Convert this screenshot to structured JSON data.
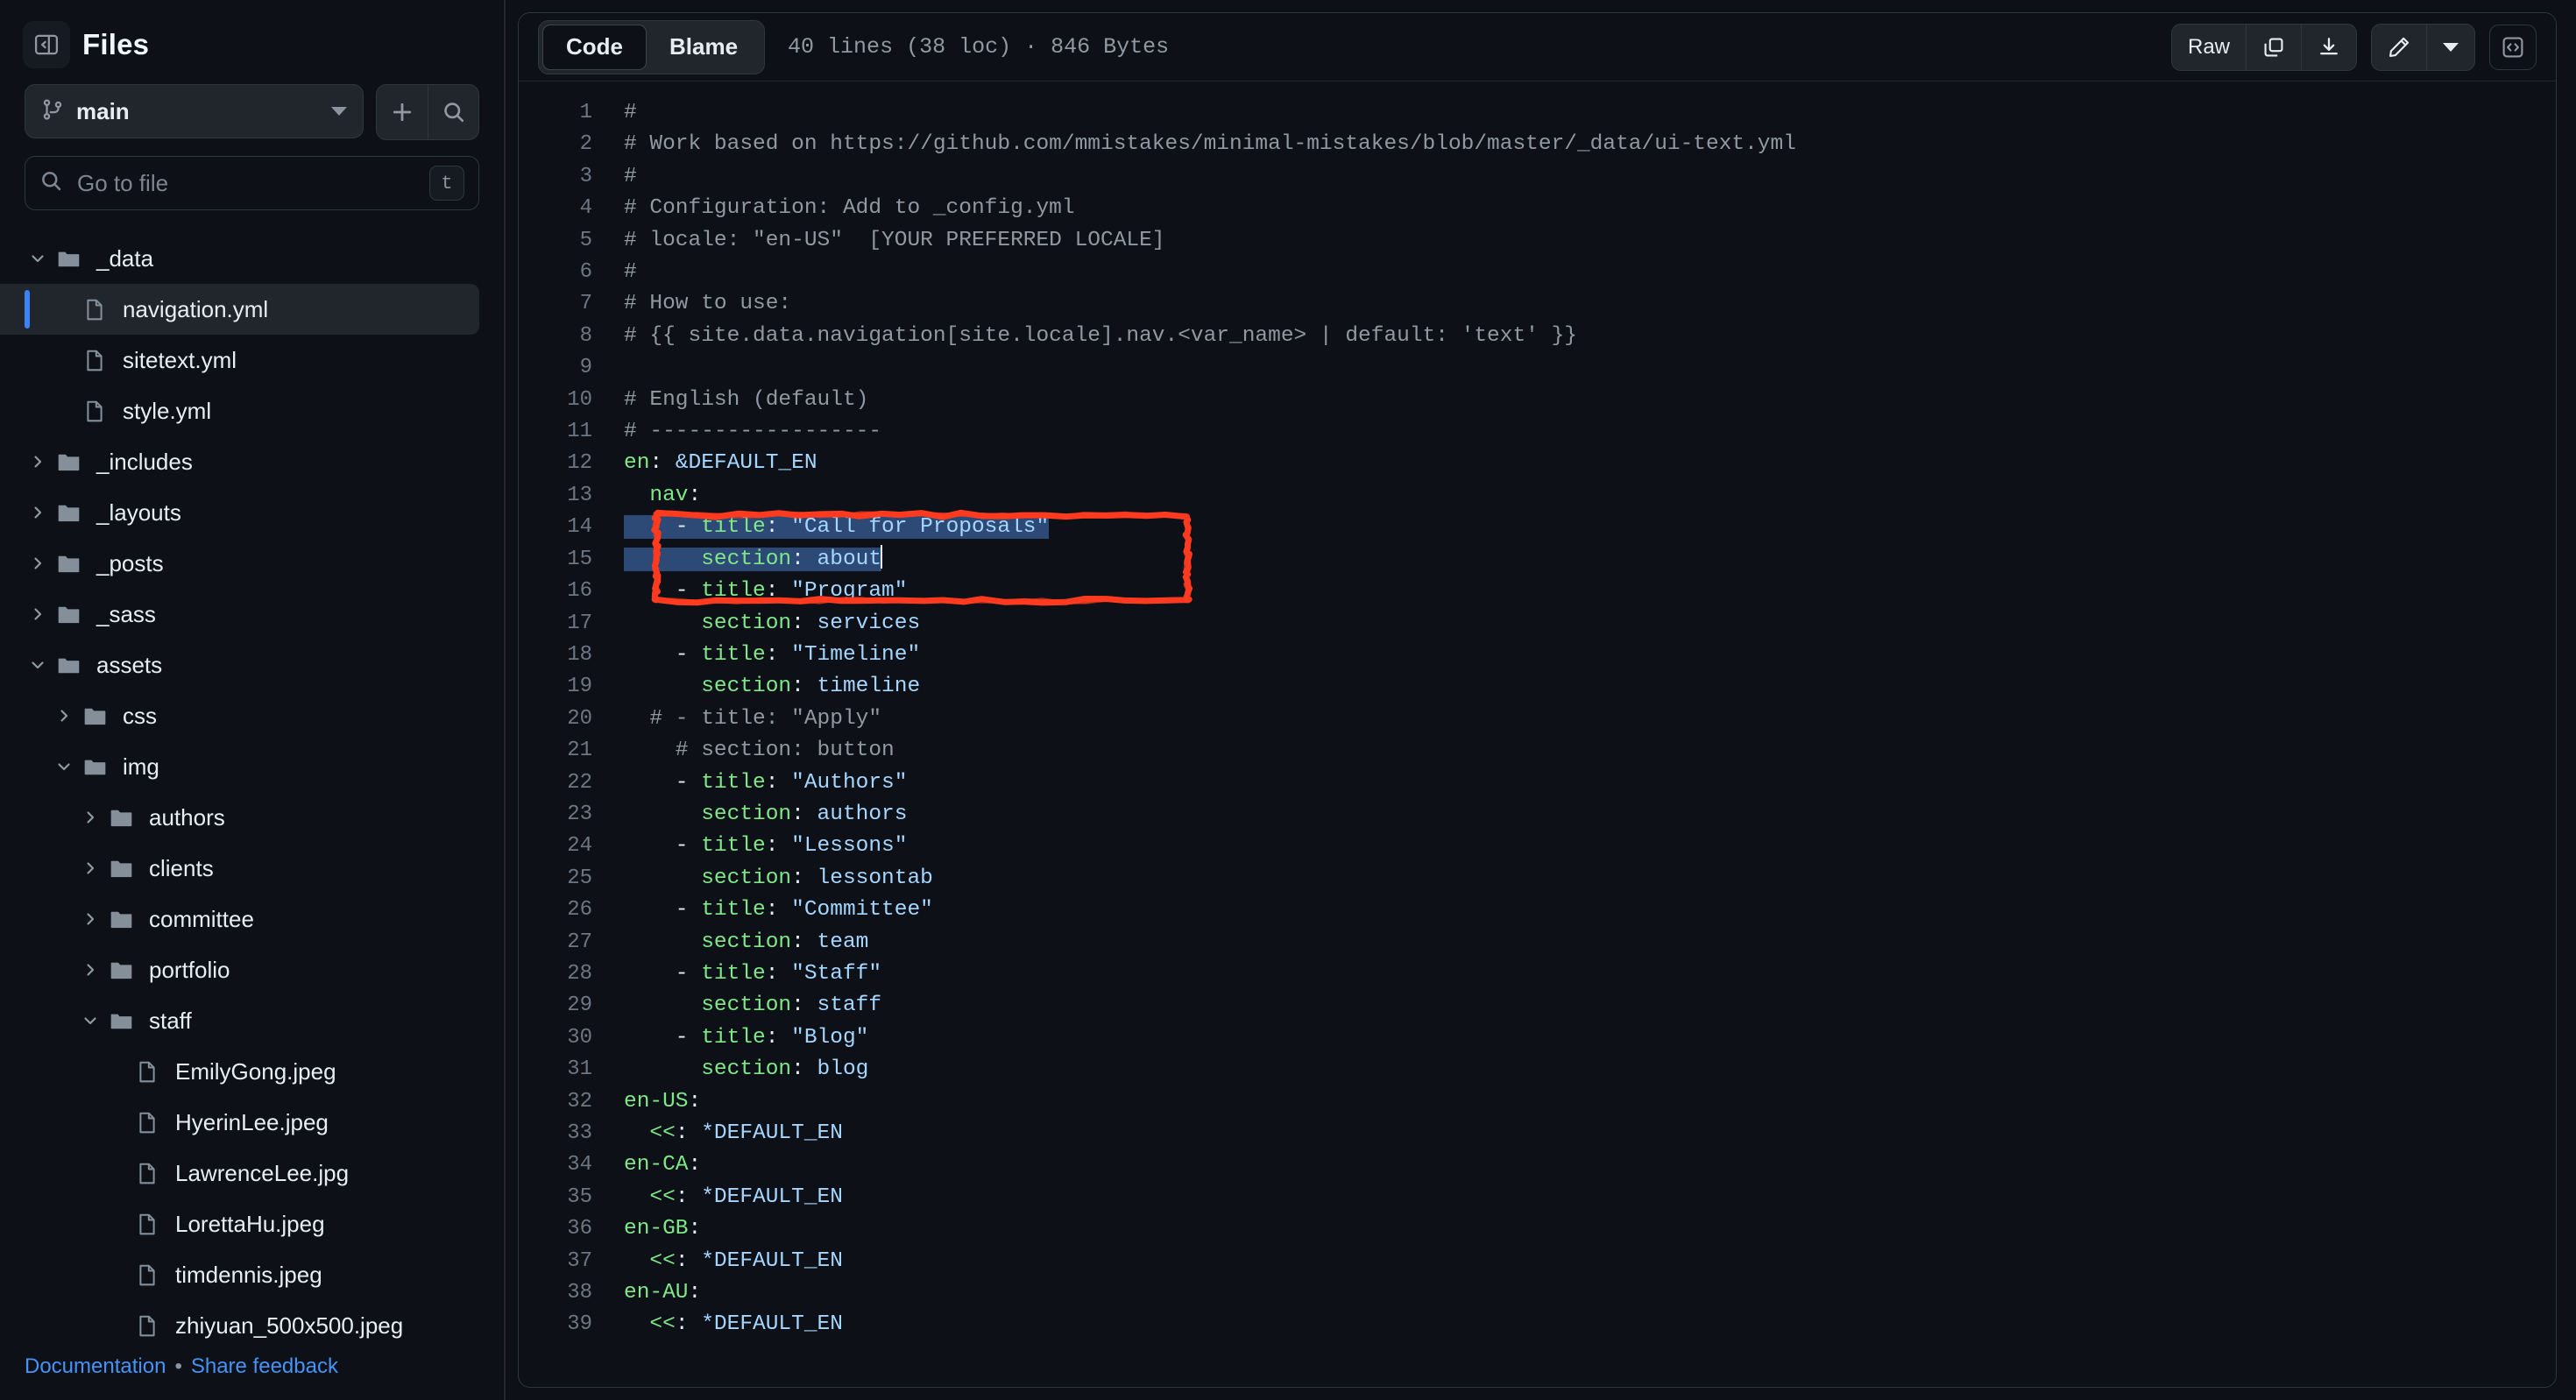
{
  "sidebar": {
    "title": "Files",
    "panel_toggle_icon": "sidebar-collapse-icon",
    "branch": {
      "name": "main",
      "icon": "git-branch-icon"
    },
    "add_button_icon": "plus-icon",
    "search_button_icon": "search-icon",
    "file_search": {
      "placeholder": "Go to file",
      "shortcut": "t",
      "icon": "search-icon"
    },
    "tree": [
      {
        "label": "_data",
        "type": "folder",
        "depth": 0,
        "state": "expanded",
        "selected": false
      },
      {
        "label": "navigation.yml",
        "type": "file",
        "depth": 1,
        "state": "none",
        "selected": true
      },
      {
        "label": "sitetext.yml",
        "type": "file",
        "depth": 1,
        "state": "none",
        "selected": false
      },
      {
        "label": "style.yml",
        "type": "file",
        "depth": 1,
        "state": "none",
        "selected": false
      },
      {
        "label": "_includes",
        "type": "folder",
        "depth": 0,
        "state": "collapsed",
        "selected": false
      },
      {
        "label": "_layouts",
        "type": "folder",
        "depth": 0,
        "state": "collapsed",
        "selected": false
      },
      {
        "label": "_posts",
        "type": "folder",
        "depth": 0,
        "state": "collapsed",
        "selected": false
      },
      {
        "label": "_sass",
        "type": "folder",
        "depth": 0,
        "state": "collapsed",
        "selected": false
      },
      {
        "label": "assets",
        "type": "folder",
        "depth": 0,
        "state": "expanded",
        "selected": false
      },
      {
        "label": "css",
        "type": "folder",
        "depth": 1,
        "state": "collapsed",
        "selected": false
      },
      {
        "label": "img",
        "type": "folder",
        "depth": 1,
        "state": "expanded",
        "selected": false
      },
      {
        "label": "authors",
        "type": "folder",
        "depth": 2,
        "state": "collapsed",
        "selected": false
      },
      {
        "label": "clients",
        "type": "folder",
        "depth": 2,
        "state": "collapsed",
        "selected": false
      },
      {
        "label": "committee",
        "type": "folder",
        "depth": 2,
        "state": "collapsed",
        "selected": false
      },
      {
        "label": "portfolio",
        "type": "folder",
        "depth": 2,
        "state": "collapsed",
        "selected": false
      },
      {
        "label": "staff",
        "type": "folder",
        "depth": 2,
        "state": "expanded",
        "selected": false
      },
      {
        "label": "EmilyGong.jpeg",
        "type": "file",
        "depth": 3,
        "state": "none",
        "selected": false
      },
      {
        "label": "HyerinLee.jpeg",
        "type": "file",
        "depth": 3,
        "state": "none",
        "selected": false
      },
      {
        "label": "LawrenceLee.jpg",
        "type": "file",
        "depth": 3,
        "state": "none",
        "selected": false
      },
      {
        "label": "LorettaHu.jpeg",
        "type": "file",
        "depth": 3,
        "state": "none",
        "selected": false
      },
      {
        "label": "timdennis.jpeg",
        "type": "file",
        "depth": 3,
        "state": "none",
        "selected": false
      },
      {
        "label": "zhiyuan_500x500.jpeg",
        "type": "file",
        "depth": 3,
        "state": "none",
        "selected": false
      }
    ],
    "footer": {
      "documentation": "Documentation",
      "separator": "•",
      "share_feedback": "Share feedback"
    }
  },
  "toolbar": {
    "tabs": [
      {
        "label": "Code",
        "active": true
      },
      {
        "label": "Blame",
        "active": false
      }
    ],
    "file_meta": "40 lines (38 loc) · 846 Bytes",
    "raw_label": "Raw",
    "copy_icon": "copy-icon",
    "download_icon": "download-icon",
    "edit_icon": "pencil-icon",
    "edit_caret_icon": "chevron-down-icon",
    "code_view_icon": "angle-brackets-icon"
  },
  "colors": {
    "background": "#0d1117",
    "border": "#30363d",
    "selected_file_accent": "#3b82f6",
    "selection_highlight": "#2d4a76",
    "annotation": "#ff3b1f",
    "syntax_key": "#7ee787",
    "syntax_string": "#a5d6ff",
    "syntax_comment": "#9198a1",
    "link": "#4493f8"
  },
  "code": {
    "language": "yaml",
    "lines": [
      {
        "n": 1,
        "tokens": [
          {
            "t": "#",
            "c": "cm"
          }
        ]
      },
      {
        "n": 2,
        "tokens": [
          {
            "t": "# Work based on https://github.com/mmistakes/minimal-mistakes/blob/master/_data/ui-text.yml",
            "c": "cm"
          }
        ]
      },
      {
        "n": 3,
        "tokens": [
          {
            "t": "#",
            "c": "cm"
          }
        ]
      },
      {
        "n": 4,
        "tokens": [
          {
            "t": "# Configuration: Add to _config.yml",
            "c": "cm"
          }
        ]
      },
      {
        "n": 5,
        "tokens": [
          {
            "t": "# locale: \"en-US\"  [YOUR PREFERRED LOCALE]",
            "c": "cm"
          }
        ]
      },
      {
        "n": 6,
        "tokens": [
          {
            "t": "#",
            "c": "cm"
          }
        ]
      },
      {
        "n": 7,
        "tokens": [
          {
            "t": "# How to use:",
            "c": "cm"
          }
        ]
      },
      {
        "n": 8,
        "tokens": [
          {
            "t": "# {{ site.data.navigation[site.locale].nav.<var_name> | default: 'text' }}",
            "c": "cm"
          }
        ]
      },
      {
        "n": 9,
        "tokens": []
      },
      {
        "n": 10,
        "tokens": [
          {
            "t": "# English (default)",
            "c": "cm"
          }
        ]
      },
      {
        "n": 11,
        "tokens": [
          {
            "t": "# ------------------",
            "c": "cm"
          }
        ]
      },
      {
        "n": 12,
        "tokens": [
          {
            "t": "en",
            "c": "key"
          },
          {
            "t": ": ",
            "c": "pun"
          },
          {
            "t": "&DEFAULT_EN",
            "c": "str"
          }
        ]
      },
      {
        "n": 13,
        "tokens": [
          {
            "t": "  nav",
            "c": "key"
          },
          {
            "t": ":",
            "c": "pun"
          }
        ]
      },
      {
        "n": 14,
        "tokens": [
          {
            "t": "    - ",
            "c": "pun sel"
          },
          {
            "t": "title",
            "c": "key sel"
          },
          {
            "t": ": ",
            "c": "pun sel"
          },
          {
            "t": "\"Call for Proposals\"",
            "c": "str sel"
          }
        ]
      },
      {
        "n": 15,
        "tokens": [
          {
            "t": "      ",
            "c": "pun sel"
          },
          {
            "t": "section",
            "c": "key sel"
          },
          {
            "t": ": ",
            "c": "pun sel"
          },
          {
            "t": "about",
            "c": "str sel"
          },
          {
            "t": "|CARET|",
            "c": "caret"
          }
        ]
      },
      {
        "n": 16,
        "tokens": [
          {
            "t": "    - ",
            "c": "pun"
          },
          {
            "t": "title",
            "c": "key"
          },
          {
            "t": ": ",
            "c": "pun"
          },
          {
            "t": "\"Program\"",
            "c": "str"
          }
        ]
      },
      {
        "n": 17,
        "tokens": [
          {
            "t": "      ",
            "c": "pun"
          },
          {
            "t": "section",
            "c": "key"
          },
          {
            "t": ": ",
            "c": "pun"
          },
          {
            "t": "services",
            "c": "str"
          }
        ]
      },
      {
        "n": 18,
        "tokens": [
          {
            "t": "    - ",
            "c": "pun"
          },
          {
            "t": "title",
            "c": "key"
          },
          {
            "t": ": ",
            "c": "pun"
          },
          {
            "t": "\"Timeline\"",
            "c": "str"
          }
        ]
      },
      {
        "n": 19,
        "tokens": [
          {
            "t": "      ",
            "c": "pun"
          },
          {
            "t": "section",
            "c": "key"
          },
          {
            "t": ": ",
            "c": "pun"
          },
          {
            "t": "timeline",
            "c": "str"
          }
        ]
      },
      {
        "n": 20,
        "tokens": [
          {
            "t": "  # - title: \"Apply\"",
            "c": "cm"
          }
        ]
      },
      {
        "n": 21,
        "tokens": [
          {
            "t": "    # section: button",
            "c": "cm"
          }
        ]
      },
      {
        "n": 22,
        "tokens": [
          {
            "t": "    - ",
            "c": "pun"
          },
          {
            "t": "title",
            "c": "key"
          },
          {
            "t": ": ",
            "c": "pun"
          },
          {
            "t": "\"Authors\"",
            "c": "str"
          }
        ]
      },
      {
        "n": 23,
        "tokens": [
          {
            "t": "      ",
            "c": "pun"
          },
          {
            "t": "section",
            "c": "key"
          },
          {
            "t": ": ",
            "c": "pun"
          },
          {
            "t": "authors",
            "c": "str"
          }
        ]
      },
      {
        "n": 24,
        "tokens": [
          {
            "t": "    - ",
            "c": "pun"
          },
          {
            "t": "title",
            "c": "key"
          },
          {
            "t": ": ",
            "c": "pun"
          },
          {
            "t": "\"Lessons\"",
            "c": "str"
          }
        ]
      },
      {
        "n": 25,
        "tokens": [
          {
            "t": "      ",
            "c": "pun"
          },
          {
            "t": "section",
            "c": "key"
          },
          {
            "t": ": ",
            "c": "pun"
          },
          {
            "t": "lessontab",
            "c": "str"
          }
        ]
      },
      {
        "n": 26,
        "tokens": [
          {
            "t": "    - ",
            "c": "pun"
          },
          {
            "t": "title",
            "c": "key"
          },
          {
            "t": ": ",
            "c": "pun"
          },
          {
            "t": "\"Committee\"",
            "c": "str"
          }
        ]
      },
      {
        "n": 27,
        "tokens": [
          {
            "t": "      ",
            "c": "pun"
          },
          {
            "t": "section",
            "c": "key"
          },
          {
            "t": ": ",
            "c": "pun"
          },
          {
            "t": "team",
            "c": "str"
          }
        ]
      },
      {
        "n": 28,
        "tokens": [
          {
            "t": "    - ",
            "c": "pun"
          },
          {
            "t": "title",
            "c": "key"
          },
          {
            "t": ": ",
            "c": "pun"
          },
          {
            "t": "\"Staff\"",
            "c": "str"
          }
        ]
      },
      {
        "n": 29,
        "tokens": [
          {
            "t": "      ",
            "c": "pun"
          },
          {
            "t": "section",
            "c": "key"
          },
          {
            "t": ": ",
            "c": "pun"
          },
          {
            "t": "staff",
            "c": "str"
          }
        ]
      },
      {
        "n": 30,
        "tokens": [
          {
            "t": "    - ",
            "c": "pun"
          },
          {
            "t": "title",
            "c": "key"
          },
          {
            "t": ": ",
            "c": "pun"
          },
          {
            "t": "\"Blog\"",
            "c": "str"
          }
        ]
      },
      {
        "n": 31,
        "tokens": [
          {
            "t": "      ",
            "c": "pun"
          },
          {
            "t": "section",
            "c": "key"
          },
          {
            "t": ": ",
            "c": "pun"
          },
          {
            "t": "blog",
            "c": "str"
          }
        ]
      },
      {
        "n": 32,
        "tokens": [
          {
            "t": "en-US",
            "c": "key"
          },
          {
            "t": ":",
            "c": "pun"
          }
        ]
      },
      {
        "n": 33,
        "tokens": [
          {
            "t": "  <<",
            "c": "key"
          },
          {
            "t": ": ",
            "c": "pun"
          },
          {
            "t": "*DEFAULT_EN",
            "c": "str"
          }
        ]
      },
      {
        "n": 34,
        "tokens": [
          {
            "t": "en-CA",
            "c": "key"
          },
          {
            "t": ":",
            "c": "pun"
          }
        ]
      },
      {
        "n": 35,
        "tokens": [
          {
            "t": "  <<",
            "c": "key"
          },
          {
            "t": ": ",
            "c": "pun"
          },
          {
            "t": "*DEFAULT_EN",
            "c": "str"
          }
        ]
      },
      {
        "n": 36,
        "tokens": [
          {
            "t": "en-GB",
            "c": "key"
          },
          {
            "t": ":",
            "c": "pun"
          }
        ]
      },
      {
        "n": 37,
        "tokens": [
          {
            "t": "  <<",
            "c": "key"
          },
          {
            "t": ": ",
            "c": "pun"
          },
          {
            "t": "*DEFAULT_EN",
            "c": "str"
          }
        ]
      },
      {
        "n": 38,
        "tokens": [
          {
            "t": "en-AU",
            "c": "key"
          },
          {
            "t": ":",
            "c": "pun"
          }
        ]
      },
      {
        "n": 39,
        "tokens": [
          {
            "t": "  <<",
            "c": "key"
          },
          {
            "t": ": ",
            "c": "pun"
          },
          {
            "t": "*DEFAULT_EN",
            "c": "str"
          }
        ]
      }
    ]
  },
  "annotation": {
    "shape": "hand-drawn-rectangle",
    "color": "#ff3b1f",
    "covers_lines": [
      14,
      15,
      16
    ]
  }
}
